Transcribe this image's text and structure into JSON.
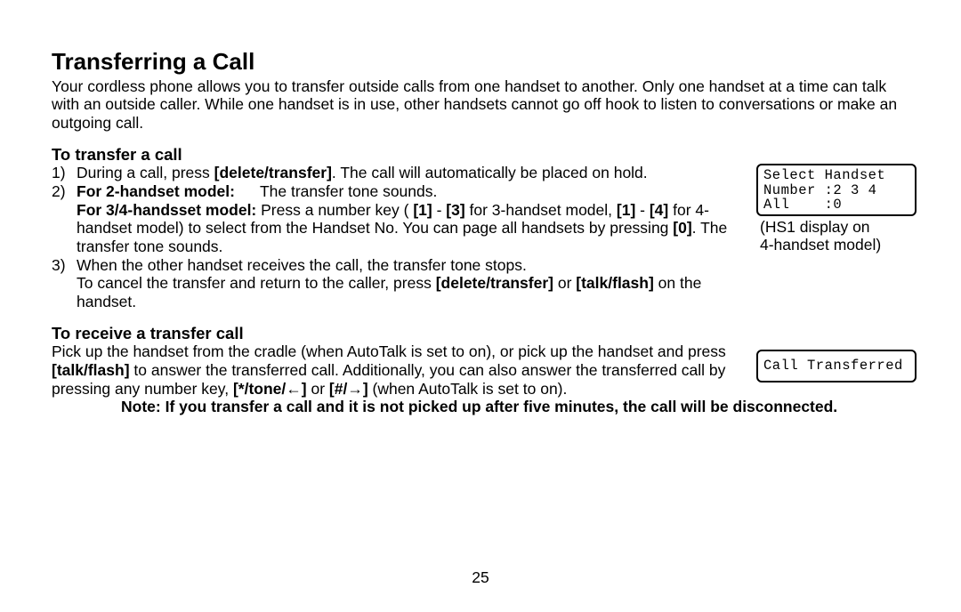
{
  "title": "Transferring a Call",
  "intro": "Your cordless phone allows you to transfer outside calls from one handset to another. Only one handset at a time can talk with an outside caller. While one handset is in use, other handsets cannot go off hook to listen to conversations or make an outgoing call.",
  "section1": {
    "heading": "To transfer a call",
    "items": {
      "n1": "1)",
      "t1a": "During a call, press ",
      "t1b": "[delete/transfer]",
      "t1c": ". The call will automatically be placed on hold.",
      "n2": "2)",
      "t2a": "For 2-handset model:",
      "t2b": "The transfer tone sounds.",
      "t2c": "For 3/4-handsset model:",
      "t2d": " Press a number key ( ",
      "t2e": "[1]",
      "t2f": " - ",
      "t2g": "[3]",
      "t2h": " for 3-handset model, ",
      "t2i": "[1]",
      "t2j": " - ",
      "t2k": "[4]",
      "t2l": " for 4-handset model) to select from the Handset No. You can page all handsets by pressing ",
      "t2m": "[0]",
      "t2n": ". The transfer tone sounds.",
      "n3": "3)",
      "t3a": "When the other handset receives the call, the transfer tone stops.",
      "t3b": "To cancel the transfer and return to the caller, press ",
      "t3c": "[delete/transfer]",
      "t3d": " or ",
      "t3e": "[talk/flash]",
      "t3f": " on the handset."
    }
  },
  "lcd1": {
    "line1": "Select Handset",
    "line2": "Number :2 3 4",
    "line3": "All    :0"
  },
  "caption1a": "(HS1 display on",
  "caption1b": "4-handset model)",
  "section2": {
    "heading": "To receive a transfer call",
    "t1": "Pick up the handset from the cradle (when AutoTalk is set to on), or pick up the handset and press ",
    "t2": "[talk/flash]",
    "t3": " to answer the transferred call. Additionally, you can also answer the transferred call by pressing any number key, ",
    "t4": "[*/tone/←]",
    "t5": " or ",
    "t6": "[#/→]",
    "t7": " (when AutoTalk is set to on)."
  },
  "lcd2": "Call Transferred",
  "note": "Note: If you transfer a call and it is not picked up after five minutes, the call will be disconnected.",
  "pagenum": "25"
}
